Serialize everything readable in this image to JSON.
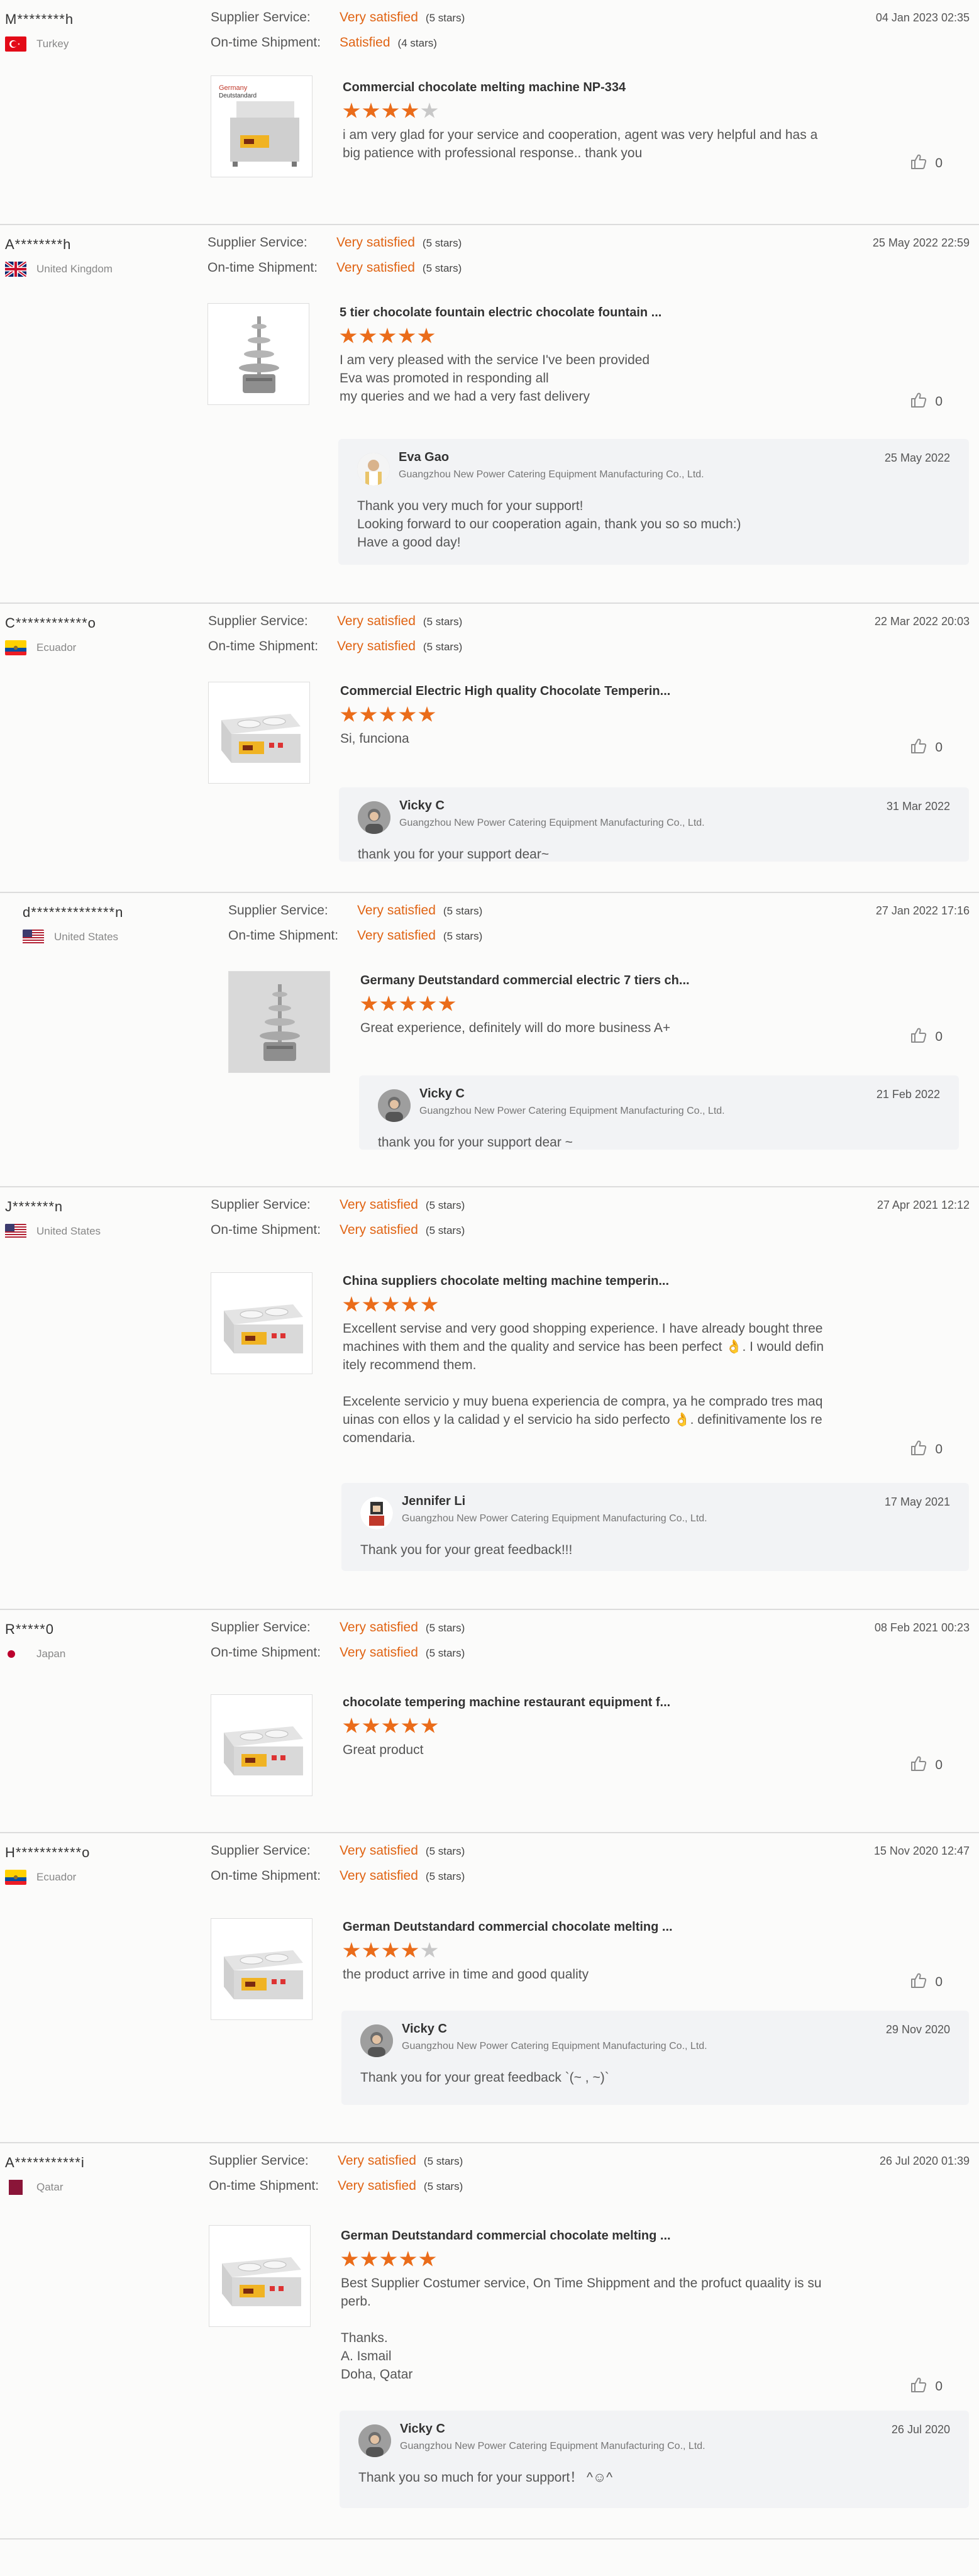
{
  "labels": {
    "supplier_service": "Supplier Service:",
    "on_time_shipment": "On-time Shipment:"
  },
  "colors": {
    "accent": "#ea6c1a",
    "star_off": "#c8c8c8"
  },
  "reviews": [
    {
      "buyer": "M********h",
      "country": "Turkey",
      "flag": "turkey-flag",
      "date": "04 Jan 2023 02:35",
      "supplier_service": "Very satisfied",
      "supplier_service_stars": "(5 stars)",
      "on_time_shipment": "Satisfied",
      "on_time_shipment_stars": "(4 stars)",
      "product_title": "Commercial chocolate melting machine NP-334",
      "product_image": "melting-machine-np334-image",
      "rating": 4,
      "comment": "i am very glad for your service and cooperation, agent was very helpful and has a\nbig patience with professional response.. thank you",
      "likes": "0",
      "reply": null
    },
    {
      "buyer": "A********h",
      "country": "United Kingdom",
      "flag": "uk-flag",
      "date": "25 May 2022 22:59",
      "supplier_service": "Very satisfied",
      "supplier_service_stars": "(5 stars)",
      "on_time_shipment": "Very satisfied",
      "on_time_shipment_stars": "(5 stars)",
      "product_title": "5 tier chocolate fountain electric chocolate fountain ...",
      "product_image": "chocolate-fountain-image",
      "rating": 5,
      "comment": "I am very pleased with the service I've been provided\nEva was promoted in responding all\nmy queries and we had a very fast delivery",
      "likes": "0",
      "reply": {
        "name": "Eva Gao",
        "company": "Guangzhou New Power Catering Equipment Manufacturing Co., Ltd.",
        "date": "25 May 2022",
        "text": "Thank you very much for your support!\nLooking forward to our cooperation again, thank you so so much:)\nHave a good day!"
      }
    },
    {
      "buyer": "C************o",
      "country": "Ecuador",
      "flag": "ecuador-flag",
      "date": "22 Mar 2022 20:03",
      "supplier_service": "Very satisfied",
      "supplier_service_stars": "(5 stars)",
      "on_time_shipment": "Very satisfied",
      "on_time_shipment_stars": "(5 stars)",
      "product_title": "Commercial Electric High quality Chocolate Temperin...",
      "product_image": "tempering-machine-image",
      "rating": 5,
      "comment": "Si, funciona",
      "likes": "0",
      "reply": {
        "name": "Vicky C",
        "company": "Guangzhou New Power Catering Equipment Manufacturing Co., Ltd.",
        "date": "31 Mar 2022",
        "text": "thank you for your support dear~"
      }
    },
    {
      "buyer": "d**************n",
      "country": "United States",
      "flag": "usa-flag",
      "date": "27 Jan 2022 17:16",
      "supplier_service": "Very satisfied",
      "supplier_service_stars": "(5 stars)",
      "on_time_shipment": "Very satisfied",
      "on_time_shipment_stars": "(5 stars)",
      "product_title": "Germany Deutstandard commercial electric 7 tiers ch...",
      "product_image": "seven-tier-fountain-image",
      "rating": 5,
      "comment": "Great experience, definitely will do more business A+",
      "likes": "0",
      "reply": {
        "name": "Vicky C",
        "company": "Guangzhou New Power Catering Equipment Manufacturing Co., Ltd.",
        "date": "21 Feb 2022",
        "text": "thank you for your support dear ~"
      }
    },
    {
      "buyer": "J*******n",
      "country": "United States",
      "flag": "usa-flag",
      "date": "27 Apr 2021 12:12",
      "supplier_service": "Very satisfied",
      "supplier_service_stars": "(5 stars)",
      "on_time_shipment": "Very satisfied",
      "on_time_shipment_stars": "(5 stars)",
      "product_title": "China suppliers chocolate melting machine temperin...",
      "product_image": "tempering-machine-image",
      "rating": 5,
      "comment": "Excellent servise and very good shopping experience. I have already bought three\nmachines with them and the quality and service has been perfect 👌. I would defin\nitely recommend them.\n\nExcelente servicio y muy buena experiencia de compra, ya he comprado tres maq\nuinas con ellos y la calidad y el servicio ha sido perfecto 👌. definitivamente los re\ncomendaria.",
      "likes": "0",
      "reply": {
        "name": "Jennifer Li",
        "company": "Guangzhou New Power Catering Equipment Manufacturing Co., Ltd.",
        "date": "17 May 2021",
        "text": "Thank you for your great feedback!!!"
      }
    },
    {
      "buyer": "R*****0",
      "country": "Japan",
      "flag": "japan-flag",
      "date": "08 Feb 2021 00:23",
      "supplier_service": "Very satisfied",
      "supplier_service_stars": "(5 stars)",
      "on_time_shipment": "Very satisfied",
      "on_time_shipment_stars": "(5 stars)",
      "product_title": "chocolate tempering machine restaurant equipment f...",
      "product_image": "tempering-machine-image",
      "rating": 5,
      "comment": "Great product",
      "likes": "0",
      "reply": null
    },
    {
      "buyer": "H***********o",
      "country": "Ecuador",
      "flag": "ecuador-flag",
      "date": "15 Nov 2020 12:47",
      "supplier_service": "Very satisfied",
      "supplier_service_stars": "(5 stars)",
      "on_time_shipment": "Very satisfied",
      "on_time_shipment_stars": "(5 stars)",
      "product_title": "German Deutstandard commercial chocolate melting ...",
      "product_image": "melting-machine-image",
      "rating": 4,
      "comment": "the product arrive in time and good quality",
      "likes": "0",
      "reply": {
        "name": "Vicky C",
        "company": "Guangzhou New Power Catering Equipment Manufacturing Co., Ltd.",
        "date": "29 Nov 2020",
        "text": "Thank you for your great feedback `(~ , ~)`"
      }
    },
    {
      "buyer": "A***********i",
      "country": "Qatar",
      "flag": "qatar-flag",
      "date": "26 Jul 2020 01:39",
      "supplier_service": "Very satisfied",
      "supplier_service_stars": "(5 stars)",
      "on_time_shipment": "Very satisfied",
      "on_time_shipment_stars": "(5 stars)",
      "product_title": "German Deutstandard commercial chocolate melting ...",
      "product_image": "melting-machine-image",
      "rating": 5,
      "comment": "Best Supplier Costumer service, On Time Shippment and the profuct quaality is su\nperb.\n\nThanks.\nA. Ismail\nDoha, Qatar",
      "likes": "0",
      "reply": {
        "name": "Vicky C",
        "company": "Guangzhou New Power Catering Equipment Manufacturing Co., Ltd.",
        "date": "26 Jul 2020",
        "text": "Thank you so much for your support！ ^☺^"
      }
    }
  ]
}
